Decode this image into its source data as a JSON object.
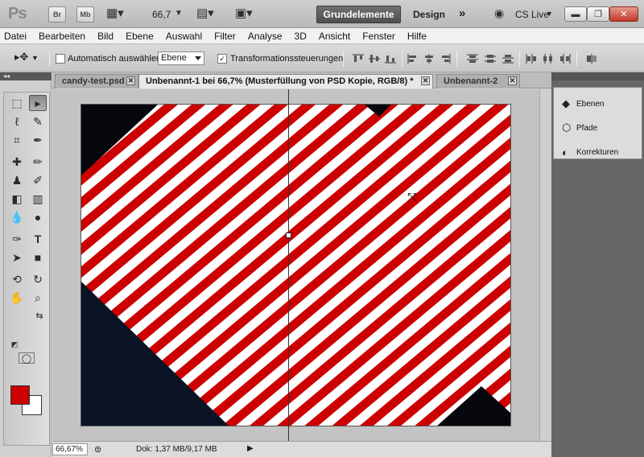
{
  "app": {
    "logo": "Ps",
    "bridge_button": "Br",
    "minibridge_button": "Mb",
    "zoom_value": "66,7",
    "workspaces": {
      "active": "Grundelemente",
      "other": "Design",
      "more": "»"
    },
    "cs_live": "CS Live"
  },
  "menu": [
    "Datei",
    "Bearbeiten",
    "Bild",
    "Ebene",
    "Auswahl",
    "Filter",
    "Analyse",
    "3D",
    "Ansicht",
    "Fenster",
    "Hilfe"
  ],
  "options": {
    "auto_select_label": "Automatisch auswählen:",
    "auto_select_checked": false,
    "auto_select_value": "Ebene",
    "transform_label": "Transformationssteuerungen",
    "transform_checked": true
  },
  "tabs": [
    {
      "label": "candy-test.psd",
      "active": false
    },
    {
      "label": "Unbenannt-1 bei 66,7% (Musterfüllung von PSD Kopie, RGB/8) *",
      "active": true
    },
    {
      "label": "Unbenannt-2",
      "active": false
    }
  ],
  "panels": [
    {
      "label": "Ebenen",
      "icon": "layers-icon"
    },
    {
      "label": "Pfade",
      "icon": "paths-icon"
    },
    {
      "label": "Korrekturen",
      "icon": "adjustments-icon"
    }
  ],
  "status": {
    "zoom": "66,67%",
    "doc_info": "Dok: 1,37 MB/9,17 MB"
  },
  "colors": {
    "foreground": "#cc0000",
    "background": "#ffffff",
    "stripe_red": "#cc0000",
    "stripe_white": "#ffffff",
    "dark_fill": "#0a1020"
  }
}
